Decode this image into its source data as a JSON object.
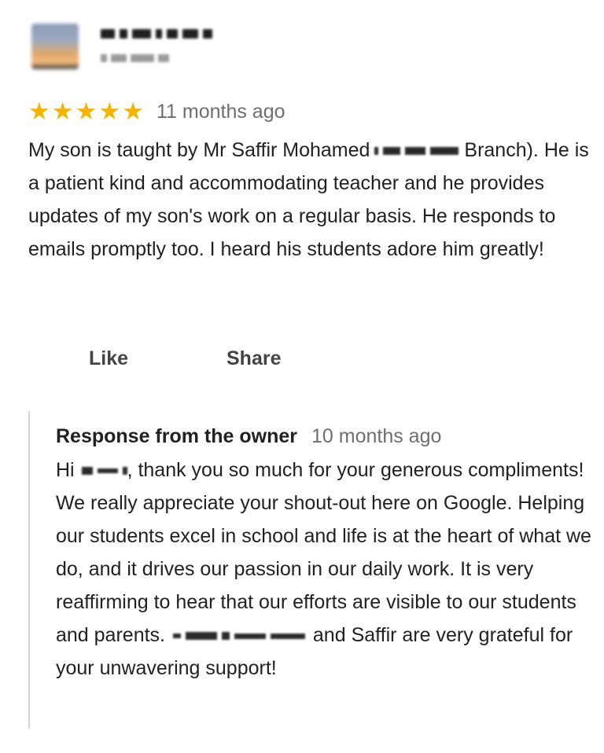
{
  "review": {
    "rating": 5,
    "stars": [
      "★",
      "★",
      "★",
      "★",
      "★"
    ],
    "time_ago": "11 months ago",
    "text_before_redaction": "My son is taught by Mr Saffir Mohamed",
    "text_after_redaction": "Branch). He is a patient kind and accommodating teacher and he provides updates of my son's work on a regular basis. He responds to emails promptly too. I heard his students adore him greatly!"
  },
  "actions": {
    "like_label": "Like",
    "share_label": "Share"
  },
  "owner_response": {
    "title": "Response from the owner",
    "time_ago": "10 months ago",
    "greeting": "Hi",
    "text_part1": ", thank you so much for your generous compliments! We really appreciate your shout-out here on Google. Helping our students excel in school and life is at the heart of what we do, and it drives our passion in our daily work. It is very reaffirming to hear that our efforts are visible to our students and parents.",
    "text_part2": "and Saffir are very grateful for your unwavering support!"
  },
  "colors": {
    "star": "#f4b400",
    "muted_text": "#6e6e6e",
    "body_text": "#212121",
    "divider": "#d6d6d6"
  }
}
